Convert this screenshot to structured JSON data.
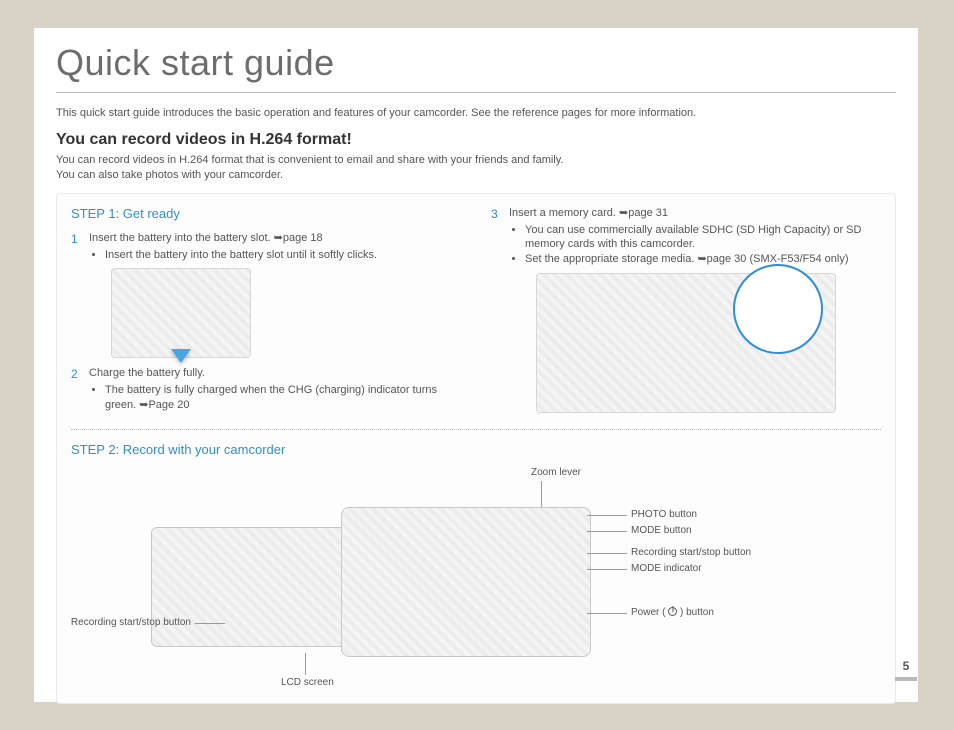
{
  "title": "Quick start guide",
  "intro": "This quick start guide introduces the basic operation and features of your camcorder. See the reference pages for more information.",
  "heading": "You can record videos in H.264 format!",
  "desc1": "You can record videos in H.264 format that is convenient to email and share with your friends and family.",
  "desc2": "You can also take photos with your camcorder.",
  "step1": {
    "title": "STEP 1: Get ready",
    "item1": {
      "text": "Insert the battery into the battery slot. ",
      "ref": "➥page 18",
      "bullet1": "Insert the battery into the battery slot until it softly clicks."
    },
    "item2": {
      "text": "Charge the battery fully.",
      "bullet1": "The battery is fully charged when the CHG (charging) indicator turns green. ➥Page 20"
    },
    "item3": {
      "text": "Insert a memory card. ",
      "ref": "➥page 31",
      "bullet1": "You can use commercially available SDHC (SD High Capacity) or SD memory cards with this camcorder.",
      "bullet2": "Set the appropriate storage media. ➥page 30 (SMX-F53/F54 only)"
    }
  },
  "step2": {
    "title": "STEP 2: Record with your camcorder",
    "labels": {
      "zoom": "Zoom lever",
      "photo": "PHOTO button",
      "mode": "MODE button",
      "rec": "Recording start/stop button",
      "modeind": "MODE indicator",
      "power_pre": "Power ( ",
      "power_post": " ) button",
      "recleft": "Recording start/stop button",
      "lcd": "LCD screen"
    }
  },
  "page_number": "5"
}
